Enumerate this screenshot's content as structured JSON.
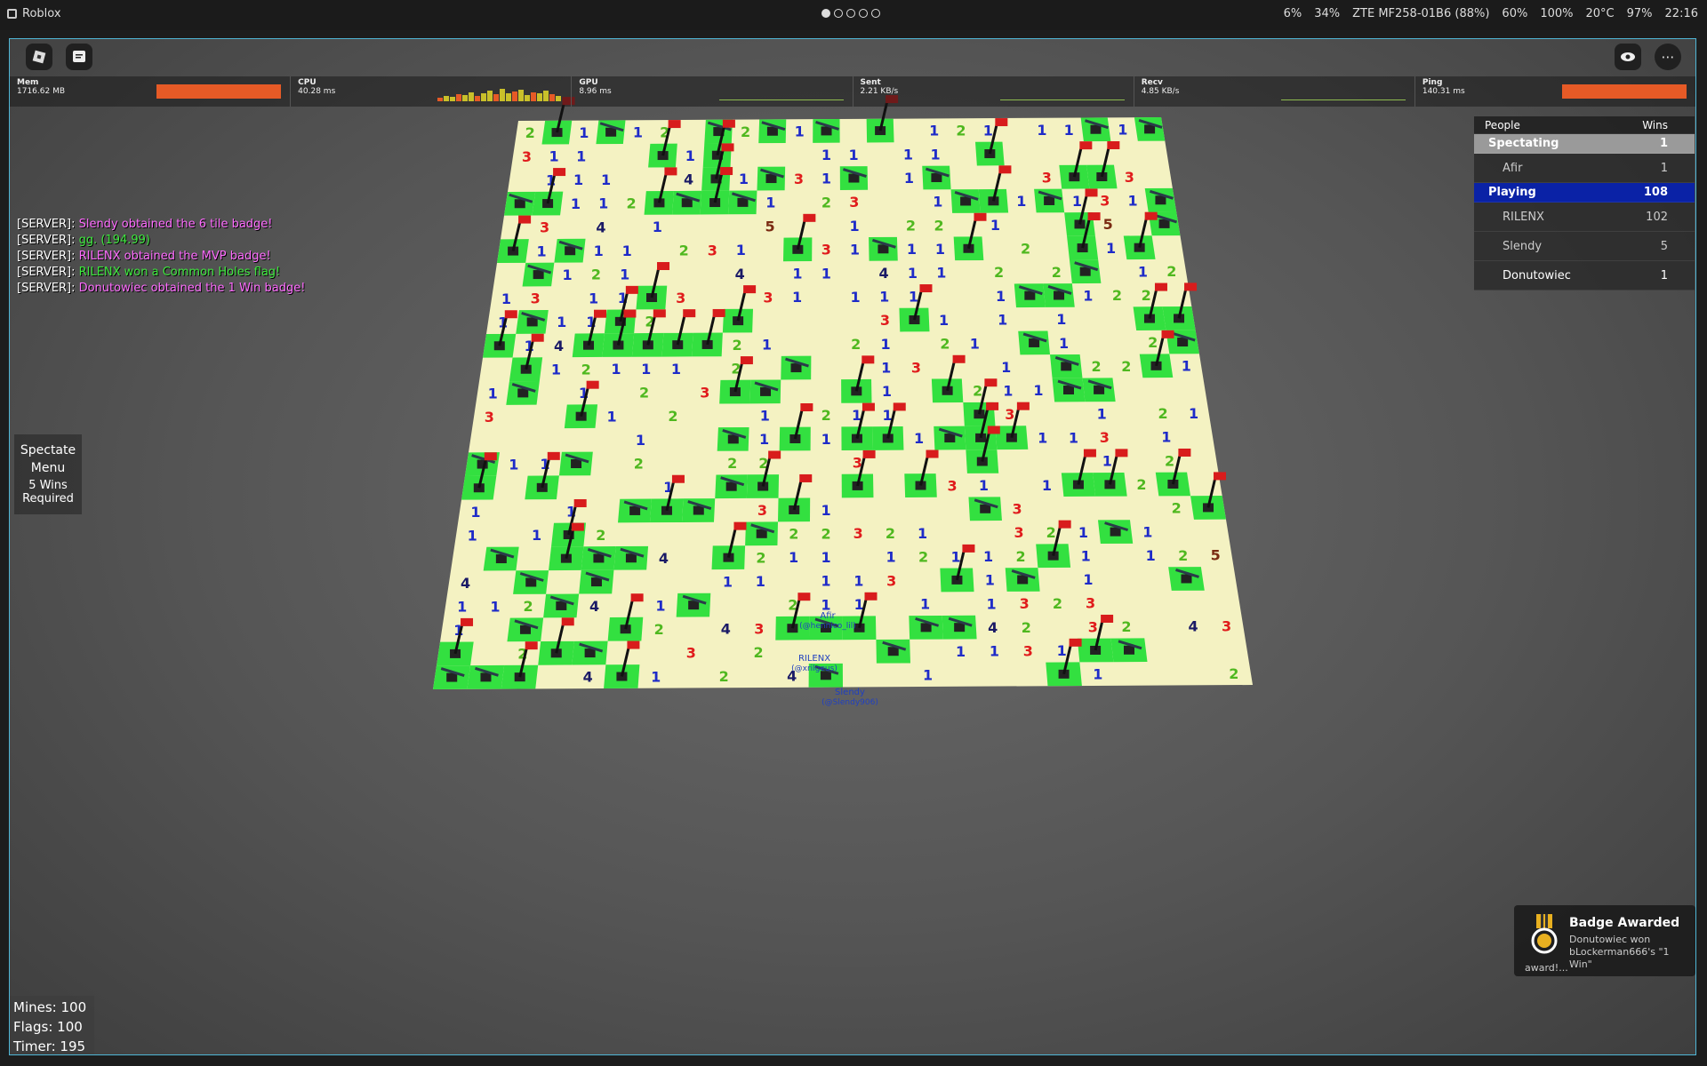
{
  "os": {
    "app_title": "Roblox",
    "tray": [
      "6%",
      "34%",
      "ZTE MF258-01B6 (88%)",
      "60%",
      "100%",
      "20°C",
      "97%",
      "22:16"
    ]
  },
  "stats": [
    {
      "name": "Mem",
      "value": "1716.62 MB"
    },
    {
      "name": "CPU",
      "value": "40.28 ms"
    },
    {
      "name": "GPU",
      "value": "8.96 ms"
    },
    {
      "name": "Sent",
      "value": "2.21 KB/s"
    },
    {
      "name": "Recv",
      "value": "4.85 KB/s"
    },
    {
      "name": "Ping",
      "value": "140.31 ms"
    }
  ],
  "chat": [
    {
      "prefix": "[SERVER]:",
      "text": " Slendy obtained the 6 tile badge!",
      "color": "#ff6cff"
    },
    {
      "prefix": "[SERVER]:",
      "text": " gg. (194.99)",
      "color": "#3ee83e"
    },
    {
      "prefix": "[SERVER]:",
      "text": " RILENX obtained the MVP badge!",
      "color": "#ff6cff"
    },
    {
      "prefix": "[SERVER]:",
      "text": " RILENX won a Common Holes flag!",
      "color": "#3ee83e"
    },
    {
      "prefix": "[SERVER]:",
      "text": " Donutowiec obtained the 1 Win badge!",
      "color": "#ff6cff"
    }
  ],
  "left_panel": {
    "spectate": "Spectate",
    "menu": "Menu",
    "wins_required": "5 Wins Required"
  },
  "leaderboard": {
    "header_people": "People",
    "header_wins": "Wins",
    "teams": [
      {
        "name": "Spectating",
        "wins": "1",
        "players": [
          {
            "name": "Afir",
            "wins": "1"
          }
        ]
      },
      {
        "name": "Playing",
        "wins": "108",
        "players": [
          {
            "name": "RILENX",
            "wins": "102"
          },
          {
            "name": "Slendy",
            "wins": "5"
          },
          {
            "name": "Donutowiec",
            "wins": "1"
          }
        ]
      }
    ]
  },
  "badge": {
    "title": "Badge Awarded",
    "body": "Donutowiec won bLockerman666's \"1 Win\"",
    "footer": "award!..."
  },
  "counters": {
    "mines": "Mines: 100",
    "flags": "Flags: 100",
    "timer": "Timer: 195"
  },
  "board_labels": [
    {
      "name": "Afir",
      "handle": "(@hennico_lil)"
    },
    {
      "name": "RILENX",
      "handle": "(@xrilgeus)"
    },
    {
      "name": "Slendy",
      "handle": "(@Slendy906)"
    }
  ],
  "number_colors": {
    "1": "#1e2bc8",
    "2": "#4fb81f",
    "3": "#e01c1c",
    "4": "#1a1a66",
    "5": "#7a2b12",
    "6": "#1a9a9a"
  }
}
